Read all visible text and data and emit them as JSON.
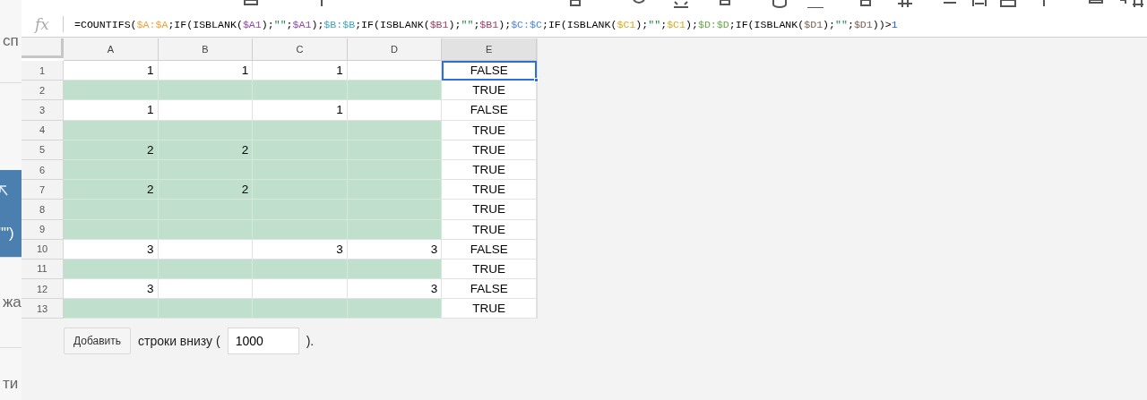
{
  "side_panel": {
    "items": [
      {
        "kind": "plain",
        "text": "сп"
      },
      {
        "kind": "highlight",
        "text": "\"\")"
      },
      {
        "kind": "plain",
        "text": "жа"
      },
      {
        "kind": "plain",
        "text": "ти"
      }
    ]
  },
  "formula_bar": {
    "label": "fx",
    "formula": "=COUNTIFS($A:$A;IF(ISBLANK($A1);\"\";$A1);$B:$B;IF(ISBLANK($B1);\"\";$B1);$C:$C;IF(ISBLANK($C1);\"\";$C1);$D:$D;IF(ISBLANK($D1);\"\";$D1))>1"
  },
  "grid": {
    "columns": [
      {
        "label": "A",
        "kind": "number",
        "selected": false
      },
      {
        "label": "B",
        "kind": "number",
        "selected": false
      },
      {
        "label": "C",
        "kind": "number",
        "selected": false
      },
      {
        "label": "D",
        "kind": "number",
        "selected": false
      },
      {
        "label": "E",
        "kind": "boolean",
        "selected": true
      }
    ],
    "rows": [
      {
        "number": "1",
        "highlighted": false,
        "cells": [
          {
            "text": "1",
            "selected": false
          },
          {
            "text": "1",
            "selected": false
          },
          {
            "text": "1",
            "selected": false
          },
          {
            "selected": false
          },
          {
            "text": "FALSE",
            "selected": true
          }
        ]
      },
      {
        "number": "2",
        "highlighted": true,
        "cells": [
          {
            "selected": false
          },
          {
            "selected": false
          },
          {
            "selected": false
          },
          {
            "selected": false
          },
          {
            "text": "TRUE",
            "selected": false
          }
        ]
      },
      {
        "number": "3",
        "highlighted": false,
        "cells": [
          {
            "text": "1",
            "selected": false
          },
          {
            "selected": false
          },
          {
            "text": "1",
            "selected": false
          },
          {
            "selected": false
          },
          {
            "text": "FALSE",
            "selected": false
          }
        ]
      },
      {
        "number": "4",
        "highlighted": true,
        "cells": [
          {
            "selected": false
          },
          {
            "selected": false
          },
          {
            "selected": false
          },
          {
            "selected": false
          },
          {
            "text": "TRUE",
            "selected": false
          }
        ]
      },
      {
        "number": "5",
        "highlighted": true,
        "cells": [
          {
            "text": "2",
            "selected": false
          },
          {
            "text": "2",
            "selected": false
          },
          {
            "selected": false
          },
          {
            "selected": false
          },
          {
            "text": "TRUE",
            "selected": false
          }
        ]
      },
      {
        "number": "6",
        "highlighted": true,
        "cells": [
          {
            "selected": false
          },
          {
            "selected": false
          },
          {
            "selected": false
          },
          {
            "selected": false
          },
          {
            "text": "TRUE",
            "selected": false
          }
        ]
      },
      {
        "number": "7",
        "highlighted": true,
        "cells": [
          {
            "text": "2",
            "selected": false
          },
          {
            "text": "2",
            "selected": false
          },
          {
            "selected": false
          },
          {
            "selected": false
          },
          {
            "text": "TRUE",
            "selected": false
          }
        ]
      },
      {
        "number": "8",
        "highlighted": true,
        "cells": [
          {
            "selected": false
          },
          {
            "selected": false
          },
          {
            "selected": false
          },
          {
            "selected": false
          },
          {
            "text": "TRUE",
            "selected": false
          }
        ]
      },
      {
        "number": "9",
        "highlighted": true,
        "cells": [
          {
            "selected": false
          },
          {
            "selected": false
          },
          {
            "selected": false
          },
          {
            "selected": false
          },
          {
            "text": "TRUE",
            "selected": false
          }
        ]
      },
      {
        "number": "10",
        "highlighted": false,
        "cells": [
          {
            "text": "3",
            "selected": false
          },
          {
            "selected": false
          },
          {
            "text": "3",
            "selected": false
          },
          {
            "text": "3",
            "selected": false
          },
          {
            "text": "FALSE",
            "selected": false
          }
        ]
      },
      {
        "number": "11",
        "highlighted": true,
        "cells": [
          {
            "selected": false
          },
          {
            "selected": false
          },
          {
            "selected": false
          },
          {
            "selected": false
          },
          {
            "text": "TRUE",
            "selected": false
          }
        ]
      },
      {
        "number": "12",
        "highlighted": false,
        "cells": [
          {
            "text": "3",
            "selected": false
          },
          {
            "selected": false
          },
          {
            "selected": false
          },
          {
            "text": "3",
            "selected": false
          },
          {
            "text": "FALSE",
            "selected": false
          }
        ]
      },
      {
        "number": "13",
        "highlighted": true,
        "cells": [
          {
            "selected": false
          },
          {
            "selected": false
          },
          {
            "selected": false
          },
          {
            "selected": false
          },
          {
            "text": "TRUE",
            "selected": false
          }
        ]
      }
    ]
  },
  "add_rows": {
    "button": "Добавить",
    "text_before": "строки внизу (",
    "value": "1000",
    "text_after": ")."
  }
}
